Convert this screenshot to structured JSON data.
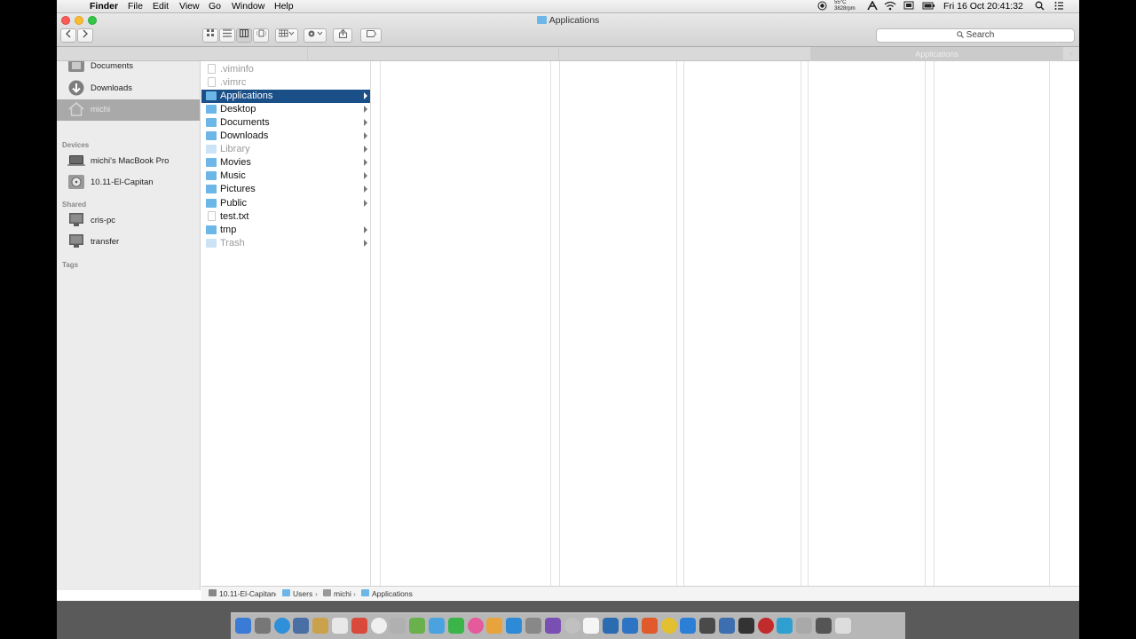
{
  "menubar": {
    "app": "Finder",
    "items": [
      "File",
      "Edit",
      "View",
      "Go",
      "Window",
      "Help"
    ],
    "temp": "55°C",
    "fan": "3828rpm",
    "datetime": "Fri 16 Oct  20:41:32"
  },
  "window": {
    "title": "Applications",
    "search_placeholder": "Search"
  },
  "column_headers": [
    "",
    "",
    "",
    "Applications"
  ],
  "sidebar": {
    "favorites": [
      {
        "label": "Documents"
      },
      {
        "label": "Downloads"
      },
      {
        "label": "michi",
        "selected": true
      }
    ],
    "devices_header": "Devices",
    "devices": [
      {
        "label": "michi's MacBook Pro"
      },
      {
        "label": "10.11-El-Capitan"
      }
    ],
    "shared_header": "Shared",
    "shared": [
      {
        "label": "cris-pc"
      },
      {
        "label": "transfer"
      }
    ],
    "tags_header": "Tags"
  },
  "column1": [
    {
      "name": ".viminfo",
      "type": "file",
      "dim": true
    },
    {
      "name": ".vimrc",
      "type": "file",
      "dim": true
    },
    {
      "name": "Applications",
      "type": "folder",
      "selected": true
    },
    {
      "name": "Desktop",
      "type": "folder"
    },
    {
      "name": "Documents",
      "type": "folder"
    },
    {
      "name": "Downloads",
      "type": "folder"
    },
    {
      "name": "Library",
      "type": "folder",
      "dim": true
    },
    {
      "name": "Movies",
      "type": "folder"
    },
    {
      "name": "Music",
      "type": "folder"
    },
    {
      "name": "Pictures",
      "type": "folder"
    },
    {
      "name": "Public",
      "type": "folder"
    },
    {
      "name": "test.txt",
      "type": "file"
    },
    {
      "name": "tmp",
      "type": "folder"
    },
    {
      "name": "Trash",
      "type": "folder",
      "dim": true
    }
  ],
  "pathbar": [
    "10.11-El-Capitan",
    "Users",
    "michi",
    "Applications"
  ],
  "colors": {
    "selection": "#1b4f88",
    "folder": "#6cb6e8",
    "sidebar_bg": "#ececec"
  }
}
